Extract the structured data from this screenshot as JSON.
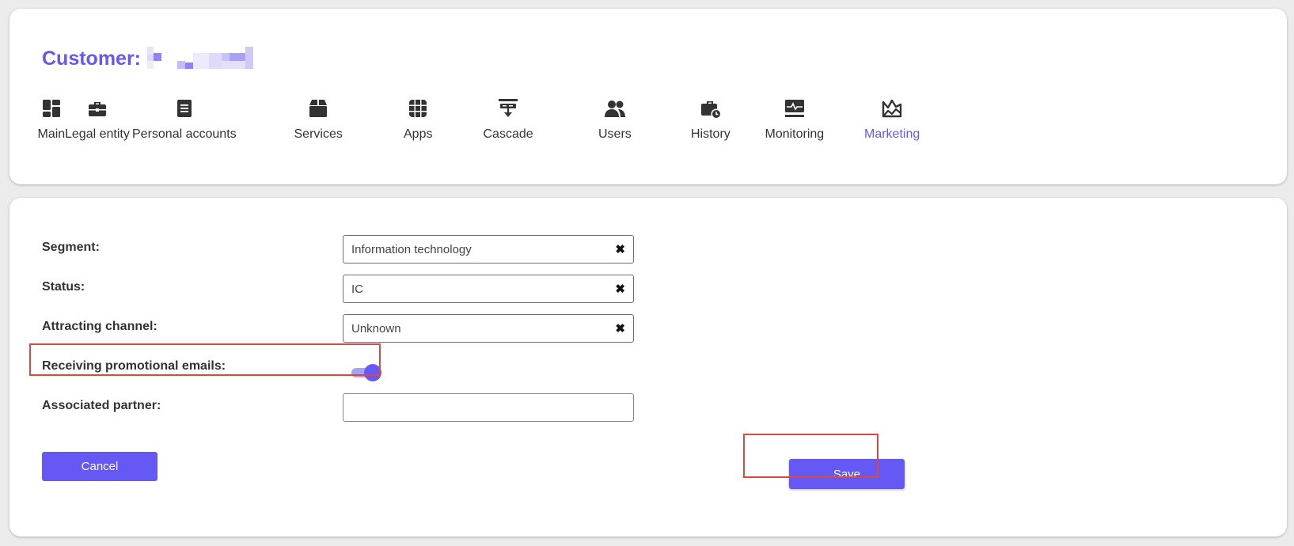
{
  "header": {
    "title": "Customer:"
  },
  "tabs": [
    {
      "label": "Main",
      "icon": "dashboard-icon"
    },
    {
      "label": "Legal entity",
      "icon": "briefcase-icon"
    },
    {
      "label": "Personal accounts",
      "icon": "document-list-icon"
    },
    {
      "label": "Services",
      "icon": "box-icon"
    },
    {
      "label": "Apps",
      "icon": "grid-icon"
    },
    {
      "label": "Cascade",
      "icon": "cascade-icon"
    },
    {
      "label": "Users",
      "icon": "users-icon"
    },
    {
      "label": "History",
      "icon": "history-briefcase-icon"
    },
    {
      "label": "Monitoring",
      "icon": "monitor-pulse-icon"
    },
    {
      "label": "Marketing",
      "icon": "marketing-chart-icon",
      "active": true
    }
  ],
  "form": {
    "segment": {
      "label": "Segment:",
      "value": "Information technology"
    },
    "status": {
      "label": "Status:",
      "value": "IC"
    },
    "channel": {
      "label": "Attracting channel:",
      "value": "Unknown"
    },
    "promo": {
      "label": "Receiving promotional emails:",
      "enabled": true
    },
    "partner": {
      "label": "Associated partner:",
      "value": ""
    }
  },
  "buttons": {
    "cancel": "Cancel",
    "save": "Save"
  },
  "colors": {
    "accent": "#6558f5",
    "highlight": "#d94a3d"
  }
}
